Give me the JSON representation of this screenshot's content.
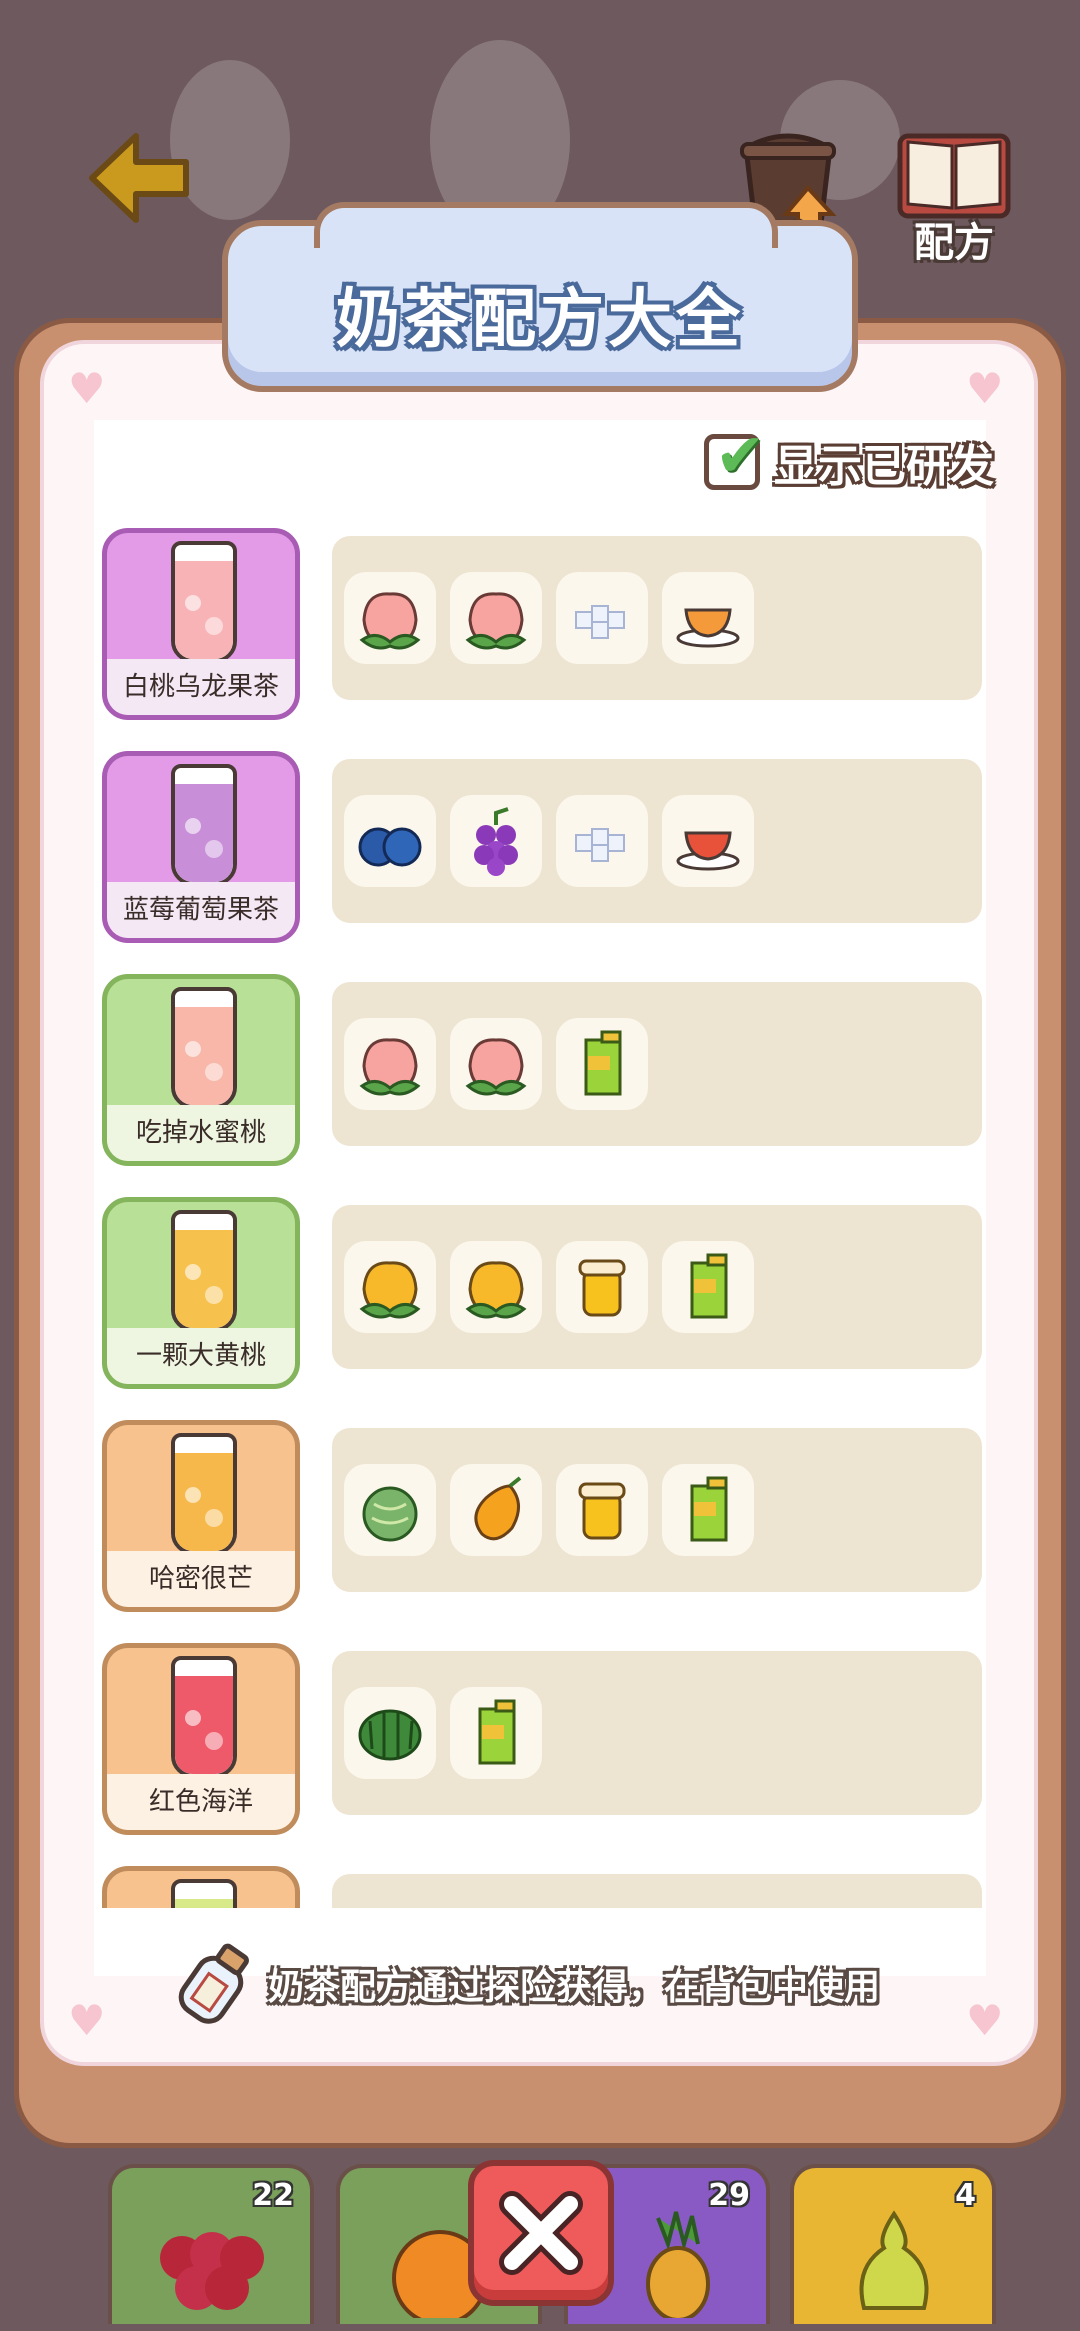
{
  "header": {
    "title": "奶茶配方大全",
    "recipe_label": "配方",
    "upgrade_label": "升级"
  },
  "toggle": {
    "label": "显示已研发",
    "checked": true
  },
  "recipes": [
    {
      "name": "白桃乌龙果茶",
      "theme": "purple",
      "liquid": "#f8b3b6",
      "ingredients": [
        "peach",
        "peach",
        "sugar",
        "tea"
      ]
    },
    {
      "name": "蓝莓葡萄果茶",
      "theme": "purple",
      "liquid": "#c88fd8",
      "ingredients": [
        "blueberry",
        "grape",
        "sugar",
        "black-tea"
      ]
    },
    {
      "name": "吃掉水蜜桃",
      "theme": "green",
      "liquid": "#f8b7a8",
      "ingredients": [
        "peach",
        "peach",
        "juice-box"
      ]
    },
    {
      "name": "一颗大黄桃",
      "theme": "green",
      "liquid": "#f7c14e",
      "ingredients": [
        "yellow-peach",
        "yellow-peach",
        "honey",
        "juice-box"
      ]
    },
    {
      "name": "哈密很芒",
      "theme": "orange",
      "liquid": "#f6b84a",
      "ingredients": [
        "melon",
        "mango",
        "honey",
        "juice-box"
      ]
    },
    {
      "name": "红色海洋",
      "theme": "orange",
      "liquid": "#ee5a6a",
      "ingredients": [
        "watermelon",
        "juice-box"
      ]
    },
    {
      "name": "",
      "theme": "orange",
      "liquid": "#d8e98a",
      "ingredients": []
    }
  ],
  "hint": {
    "text": "奶茶配方通过探险获得，在背包中使用"
  },
  "inventory": [
    {
      "item": "raspberry",
      "count": "22"
    },
    {
      "item": "orange",
      "count": ""
    },
    {
      "item": "pineapple",
      "count": "29"
    },
    {
      "item": "pear",
      "count": "4"
    }
  ],
  "colors": {
    "accent": "#ef5a5a",
    "panel": "#c8906e",
    "title_plate": "#d9e3f7"
  }
}
